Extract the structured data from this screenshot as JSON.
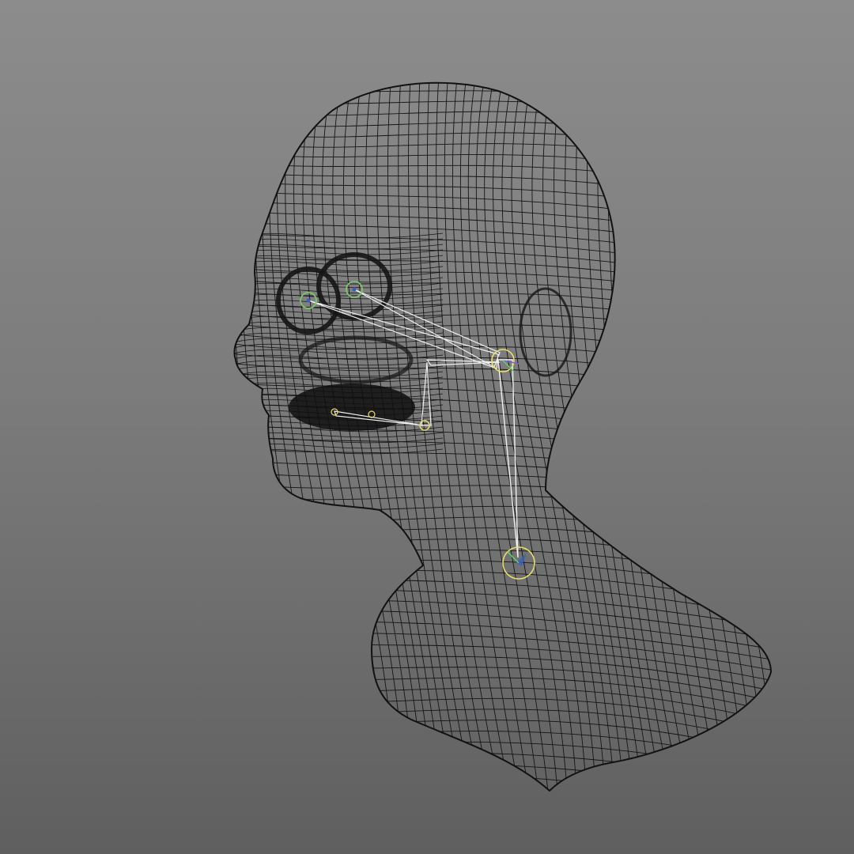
{
  "viewport": {
    "background_top": "#8c8c8c",
    "background_bottom": "#5f5f5f",
    "wire_color": "#151515",
    "bone_color": "#f0f0f0",
    "joint_color": "#e8df6a",
    "eye_joint_color": "#7dc46a"
  },
  "model": {
    "subject": "head-and-neck-wireframe",
    "display_mode": "wireframe",
    "rig": {
      "joints": [
        "neck-joint",
        "head-joint",
        "left-eye-joint",
        "right-eye-joint",
        "jaw-joint",
        "jaw-tip-joint"
      ],
      "bones": [
        "neck-to-head-bone",
        "head-to-left-eye-bone",
        "head-to-right-eye-bone",
        "head-to-jaw-bone",
        "jaw-to-tip-bone"
      ]
    }
  }
}
